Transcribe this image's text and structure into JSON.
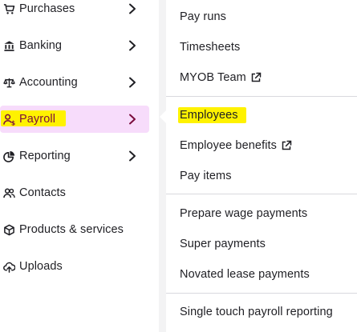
{
  "sidebar": {
    "items": [
      {
        "label": "Purchases",
        "icon": "cart-icon"
      },
      {
        "label": "Banking",
        "icon": "bank-icon"
      },
      {
        "label": "Accounting",
        "icon": "scales-icon"
      },
      {
        "label": "Payroll",
        "icon": "person-dollar-icon",
        "active": true
      },
      {
        "label": "Reporting",
        "icon": "pie-chart-icon"
      },
      {
        "label": "Contacts",
        "icon": "people-icon"
      },
      {
        "label": "Products & services",
        "icon": "box-icon"
      },
      {
        "label": "Uploads",
        "icon": "cloud-upload-icon"
      }
    ]
  },
  "payroll_menu": {
    "groups": [
      {
        "items": [
          {
            "label": "Pay runs"
          },
          {
            "label": "Timesheets"
          },
          {
            "label": "MYOB Team",
            "external": true
          }
        ]
      },
      {
        "items": [
          {
            "label": "Employees",
            "highlighted": true
          },
          {
            "label": "Employee benefits",
            "external": true
          },
          {
            "label": "Pay items"
          }
        ]
      },
      {
        "items": [
          {
            "label": "Prepare wage payments"
          },
          {
            "label": "Super payments"
          },
          {
            "label": "Novated lease payments"
          }
        ]
      },
      {
        "items": [
          {
            "label": "Single touch payroll reporting"
          }
        ]
      }
    ]
  },
  "colors": {
    "highlight": "#fff200",
    "active_bg": "#f7dcfb",
    "active_text": "#7a0d3c"
  }
}
